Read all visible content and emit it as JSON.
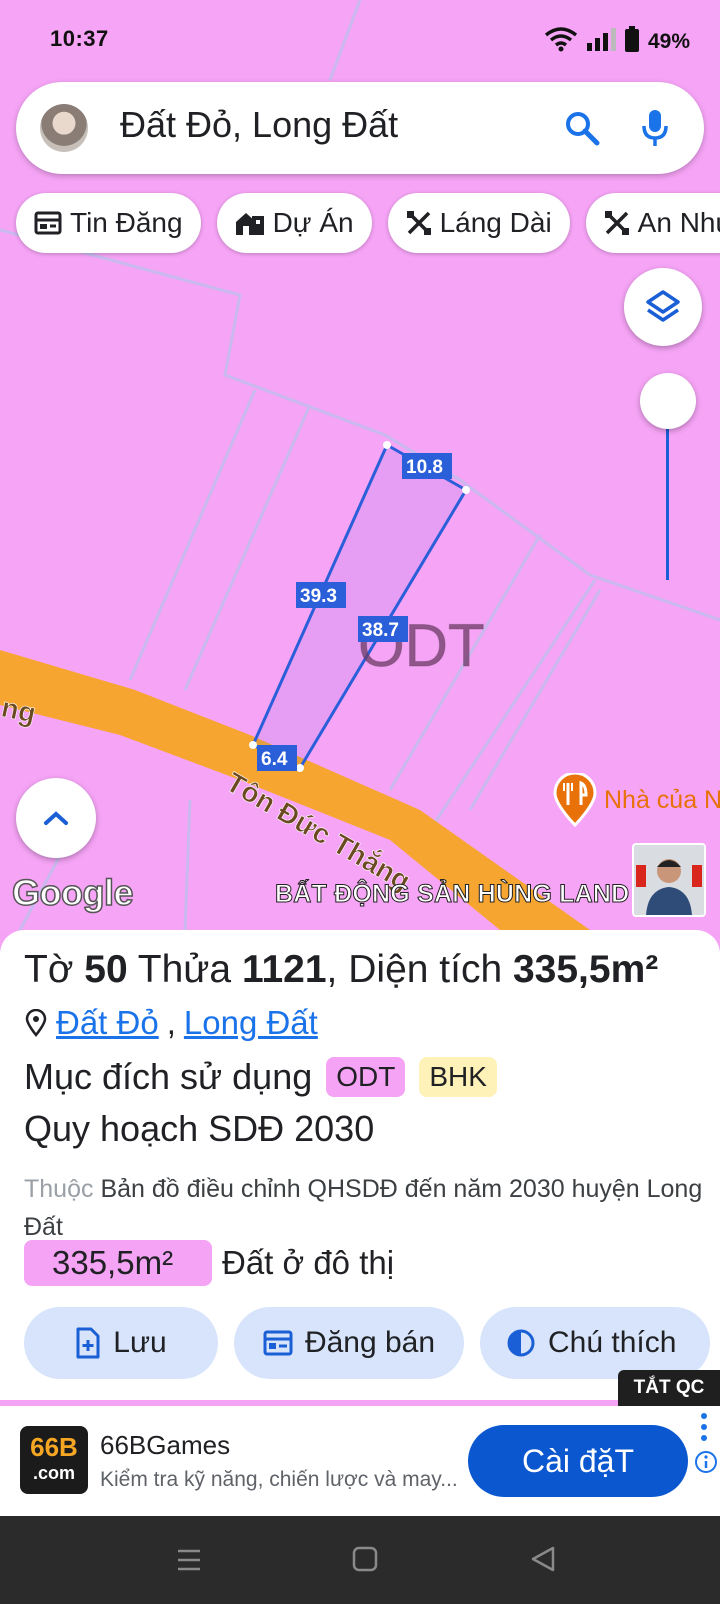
{
  "status_bar": {
    "time": "10:37",
    "battery": "49%"
  },
  "search": {
    "query": "Đất Đỏ, Long Đất"
  },
  "chips": [
    {
      "label": "Tin Đăng",
      "icon": "listing-icon"
    },
    {
      "label": "Dự Án",
      "icon": "project-icon"
    },
    {
      "label": "Láng Dài",
      "icon": "area-icon"
    },
    {
      "label": "An Nhứt",
      "icon": "area-icon"
    }
  ],
  "map": {
    "zoning_code": "ODT",
    "road_name": "Tôn Đức Thắng",
    "road_fragment": "ng",
    "edge_lengths": {
      "top": "10.8",
      "left": "39.3",
      "right": "38.7",
      "bottom": "6.4"
    },
    "poi_name": "Nhà của N",
    "attribution": "Google",
    "watermark": "BẤT ĐỘNG SẢN HÙNG LAND",
    "colors": {
      "land": "#f6a4f6",
      "road": "#f7a531",
      "parcel_outline": "#2b5fd9"
    }
  },
  "parcel": {
    "sheet_label": "Tờ",
    "sheet_no": "50",
    "plot_label": "Thửa",
    "plot_no": "1121",
    "area_label": "Diện tích",
    "area": "335,5m²",
    "location_links": [
      "Đất Đỏ",
      "Long Đất"
    ],
    "location_sep": ",",
    "purpose_label": "Mục đích sử dụng",
    "purpose_tags": [
      "ODT",
      "BHK"
    ],
    "plan_title": "Quy hoạch SDĐ 2030",
    "desc_prefix": "Thuộc",
    "desc": "Bản đồ điều chỉnh QHSDĐ đến năm 2030 huyện Long Đất",
    "zone_area": "335,5m²",
    "zone_type": "Đất ở đô thị",
    "actions": [
      "Lưu",
      "Đăng bán",
      "Chú thích"
    ]
  },
  "ad": {
    "off_label": "TẮT QC",
    "logo_top": "66B",
    "logo_bottom": ".com",
    "title": "66BGames",
    "subtitle": "Kiểm tra kỹ năng, chiến lược và may...",
    "cta": "Cài đặT"
  }
}
